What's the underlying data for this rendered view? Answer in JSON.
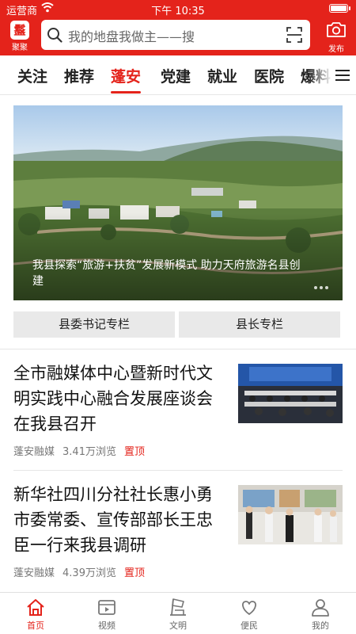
{
  "status_bar": {
    "carrier": "运营商",
    "time": "下午 10:35"
  },
  "header": {
    "logo_mark": "䰔",
    "logo_label": "聚聚",
    "search_placeholder": "我的地盘我做主——搜",
    "publish_label": "发布"
  },
  "tabs": [
    "关注",
    "推荐",
    "蓬安",
    "党建",
    "就业",
    "医院",
    "爆料"
  ],
  "active_tab": "蓬安",
  "banner": {
    "caption": "我县探索“旅游+扶贫”发展新模式 助力天府旅游名县创建"
  },
  "columns": [
    "县委书记专栏",
    "县长专栏"
  ],
  "news": [
    {
      "title": "全市融媒体中心暨新时代文明实践中心融合发展座谈会在我县召开",
      "source": "蓬安融媒",
      "views": "3.41万浏览",
      "tag": "置顶"
    },
    {
      "title": "新华社四川分社社长惠小勇市委常委、宣传部部长王忠臣一行来我县调研",
      "source": "蓬安融媒",
      "views": "4.39万浏览",
      "tag": "置顶"
    }
  ],
  "bottom_nav": [
    {
      "label": "首页",
      "icon": "home-icon"
    },
    {
      "label": "视频",
      "icon": "video-icon"
    },
    {
      "label": "文明",
      "icon": "civilization-icon"
    },
    {
      "label": "便民",
      "icon": "heart-icon"
    },
    {
      "label": "我的",
      "icon": "user-icon"
    }
  ],
  "colors": {
    "brand_red": "#e4231b",
    "tab_text": "#222222",
    "meta_text": "#777777"
  }
}
